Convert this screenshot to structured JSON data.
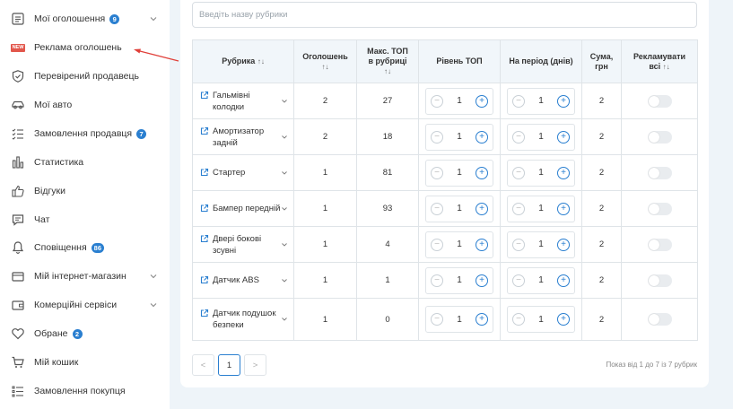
{
  "sidebar": {
    "items": [
      {
        "label": "Мої оголошення",
        "count": "9",
        "icon": "list-icon",
        "chevron": true
      },
      {
        "label": "Реклама оголошень",
        "badge": "NEW",
        "icon": "new-badge-icon"
      },
      {
        "label": "Перевірений продавець",
        "icon": "shield-icon"
      },
      {
        "label": "Мої авто",
        "icon": "car-icon"
      },
      {
        "label": "Замовлення продавця",
        "count": "7",
        "icon": "checklist-icon"
      },
      {
        "label": "Статистика",
        "icon": "bar-chart-icon"
      },
      {
        "label": "Відгуки",
        "icon": "thumbs-up-icon"
      },
      {
        "label": "Чат",
        "icon": "chat-icon"
      },
      {
        "label": "Сповіщення",
        "count": "86",
        "icon": "bell-icon"
      },
      {
        "label": "Мій інтернет-магазин",
        "icon": "store-icon",
        "chevron": true
      },
      {
        "label": "Комерційні сервіси",
        "icon": "wallet-icon",
        "chevron": true
      },
      {
        "label": "Обране",
        "count": "2",
        "icon": "heart-icon"
      },
      {
        "label": "Мій кошик",
        "icon": "cart-icon"
      },
      {
        "label": "Замовлення покупця",
        "icon": "order-list-icon"
      }
    ]
  },
  "search": {
    "placeholder": "Введіть назву рубрики",
    "value": ""
  },
  "table": {
    "headers": {
      "rubric": "Рубрика",
      "ads": "Оголошень",
      "max_top_1": "Макс. ТОП",
      "max_top_2": "в рубриці",
      "top_level": "Рівень ТОП",
      "period": "На період (днів)",
      "sum_1": "Сума,",
      "sum_2": "грн",
      "advertise_1": "Рекламувати",
      "advertise_2": "всі"
    },
    "sort_glyph": "↑↓",
    "rows": [
      {
        "name": "Гальмівні колодки",
        "ads": "2",
        "max_top": "27",
        "level": "1",
        "period": "1",
        "sum": "2"
      },
      {
        "name": "Амортизатор задній",
        "ads": "2",
        "max_top": "18",
        "level": "1",
        "period": "1",
        "sum": "2"
      },
      {
        "name": "Стартер",
        "ads": "1",
        "max_top": "81",
        "level": "1",
        "period": "1",
        "sum": "2"
      },
      {
        "name": "Бампер передній",
        "ads": "1",
        "max_top": "93",
        "level": "1",
        "period": "1",
        "sum": "2"
      },
      {
        "name": "Двері бокові зсувні",
        "ads": "1",
        "max_top": "4",
        "level": "1",
        "period": "1",
        "sum": "2"
      },
      {
        "name": "Датчик ABS",
        "ads": "1",
        "max_top": "1",
        "level": "1",
        "period": "1",
        "sum": "2"
      },
      {
        "name": "Датчик подушок безпеки",
        "ads": "1",
        "max_top": "0",
        "level": "1",
        "period": "1",
        "sum": "2"
      }
    ]
  },
  "pagination": {
    "prev": "<",
    "current": "1",
    "next": ">",
    "info": "Показ від 1 до 7 із 7 рубрик"
  },
  "colors": {
    "accent": "#2a7fd0",
    "badge_new": "#e2574c",
    "arrow": "#e0403a"
  }
}
